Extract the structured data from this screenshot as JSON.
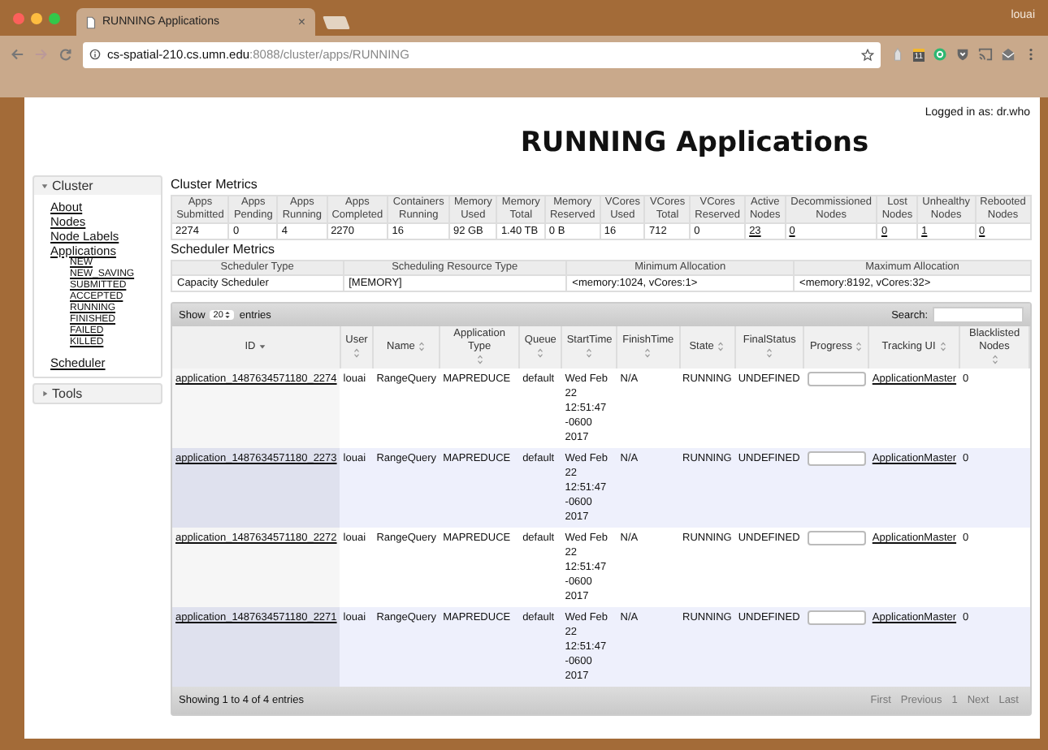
{
  "browser": {
    "tab_title": "RUNNING Applications",
    "tab_close": "×",
    "profile": "louai",
    "url_host": "cs-spatial-210.cs.umn.edu",
    "url_path": ":8088/cluster/apps/RUNNING",
    "extension_badge": "11"
  },
  "page": {
    "logged_in": "Logged in as: dr.who",
    "title": "RUNNING Applications"
  },
  "sidebar": [
    {
      "label": "Cluster",
      "expanded": true,
      "items": [
        {
          "label": "About"
        },
        {
          "label": "Nodes"
        },
        {
          "label": "Node Labels"
        },
        {
          "label": "Applications",
          "children": [
            {
              "label": "NEW"
            },
            {
              "label": "NEW_SAVING"
            },
            {
              "label": "SUBMITTED"
            },
            {
              "label": "ACCEPTED"
            },
            {
              "label": "RUNNING"
            },
            {
              "label": "FINISHED"
            },
            {
              "label": "FAILED"
            },
            {
              "label": "KILLED"
            }
          ]
        },
        {
          "label": "Scheduler"
        }
      ]
    },
    {
      "label": "Tools",
      "expanded": false
    }
  ],
  "cluster_metrics": {
    "title": "Cluster Metrics",
    "columns": [
      [
        "Apps",
        "Submitted"
      ],
      [
        "Apps",
        "Pending"
      ],
      [
        "Apps",
        "Running"
      ],
      [
        "Apps",
        "Completed"
      ],
      [
        "Containers",
        "Running"
      ],
      [
        "Memory",
        "Used"
      ],
      [
        "Memory",
        "Total"
      ],
      [
        "Memory",
        "Reserved"
      ],
      [
        "VCores",
        "Used"
      ],
      [
        "VCores",
        "Total"
      ],
      [
        "VCores",
        "Reserved"
      ],
      [
        "Active",
        "Nodes"
      ],
      [
        "Decommissioned",
        "Nodes"
      ],
      [
        "Lost",
        "Nodes"
      ],
      [
        "Unhealthy",
        "Nodes"
      ],
      [
        "Rebooted",
        "Nodes"
      ]
    ],
    "values": [
      {
        "text": "2274",
        "link": false
      },
      {
        "text": "0",
        "link": false
      },
      {
        "text": "4",
        "link": false
      },
      {
        "text": "2270",
        "link": false
      },
      {
        "text": "16",
        "link": false
      },
      {
        "text": "92 GB",
        "link": false
      },
      {
        "text": "1.40 TB",
        "link": false
      },
      {
        "text": "0 B",
        "link": false
      },
      {
        "text": "16",
        "link": false
      },
      {
        "text": "712",
        "link": false
      },
      {
        "text": "0",
        "link": false
      },
      {
        "text": "23",
        "link": true
      },
      {
        "text": "0",
        "link": true
      },
      {
        "text": "0",
        "link": true
      },
      {
        "text": "1",
        "link": true
      },
      {
        "text": "0",
        "link": true
      }
    ]
  },
  "scheduler_metrics": {
    "title": "Scheduler Metrics",
    "columns": [
      "Scheduler Type",
      "Scheduling Resource Type",
      "Minimum Allocation",
      "Maximum Allocation"
    ],
    "values": [
      "Capacity Scheduler",
      "[MEMORY]",
      "<memory:1024, vCores:1>",
      "<memory:8192, vCores:32>"
    ]
  },
  "apps_table": {
    "show_label": "Show",
    "page_size": "20",
    "entries_label": "entries",
    "search_label": "Search:",
    "columns": [
      {
        "label": "ID",
        "sorted": true
      },
      {
        "label": "User",
        "sorted": false
      },
      {
        "label": "Name",
        "sorted": false
      },
      {
        "label": "Application Type",
        "sorted": false
      },
      {
        "label": "Queue",
        "sorted": false
      },
      {
        "label": "StartTime",
        "sorted": false
      },
      {
        "label": "FinishTime",
        "sorted": false
      },
      {
        "label": "State",
        "sorted": false
      },
      {
        "label": "FinalStatus",
        "sorted": false
      },
      {
        "label": "Progress",
        "sorted": false
      },
      {
        "label": "Tracking UI",
        "sorted": false
      },
      {
        "label": "Blacklisted Nodes",
        "sorted": false
      }
    ],
    "rows": [
      {
        "id": "application_1487634571180_2274",
        "user": "louai",
        "name": "RangeQuery",
        "type": "MAPREDUCE",
        "queue": "default",
        "start": "Wed Feb 22 12:51:47 -0600 2017",
        "finish": "N/A",
        "state": "RUNNING",
        "final_status": "UNDEFINED",
        "level": 0,
        "tracking": "ApplicationMaster",
        "blacklisted": "0"
      },
      {
        "id": "application_1487634571180_2273",
        "user": "louai",
        "name": "RangeQuery",
        "type": "MAPREDUCE",
        "queue": "default",
        "start": "Wed Feb 22 12:51:47 -0600 2017",
        "finish": "N/A",
        "state": "RUNNING",
        "final_status": "UNDEFINED",
        "level": 0,
        "tracking": "ApplicationMaster",
        "blacklisted": "0"
      },
      {
        "id": "application_1487634571180_2272",
        "user": "louai",
        "name": "RangeQuery",
        "type": "MAPREDUCE",
        "queue": "default",
        "start": "Wed Feb 22 12:51:47 -0600 2017",
        "finish": "N/A",
        "state": "RUNNING",
        "final_status": "UNDEFINED",
        "level": 0,
        "tracking": "ApplicationMaster",
        "blacklisted": "0"
      },
      {
        "id": "application_1487634571180_2271",
        "user": "louai",
        "name": "RangeQuery",
        "type": "MAPREDUCE",
        "queue": "default",
        "start": "Wed Feb 22 12:51:47 -0600 2017",
        "finish": "N/A",
        "state": "RUNNING",
        "final_status": "UNDEFINED",
        "level": 0,
        "tracking": "ApplicationMaster",
        "blacklisted": "0"
      }
    ],
    "info": "Showing 1 to 4 of 4 entries",
    "pagination": [
      {
        "label": "First",
        "disabled": true
      },
      {
        "label": "Previous",
        "disabled": true
      },
      {
        "label": "1",
        "disabled": true
      },
      {
        "label": "Next",
        "disabled": true
      },
      {
        "label": "Last",
        "disabled": true
      }
    ]
  }
}
